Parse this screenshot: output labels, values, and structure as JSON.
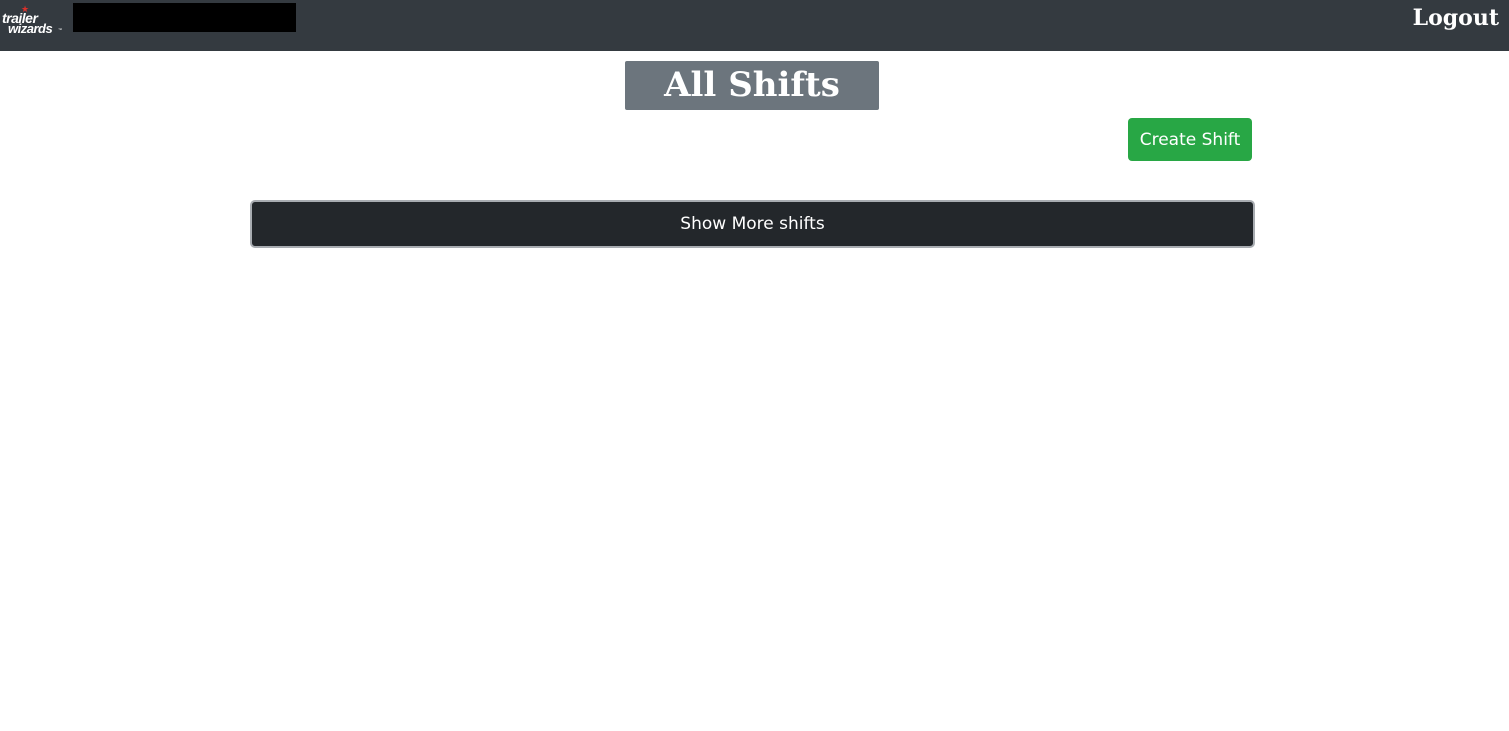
{
  "navbar": {
    "logo": {
      "line1": "trailer",
      "line2": "wizards",
      "icon": "star-icon",
      "accent_color": "#d9302a"
    },
    "logout_label": "Logout",
    "background_color": "#343a40"
  },
  "main": {
    "title": "All Shifts",
    "create_button_label": "Create Shift",
    "show_more_label": "Show More shifts"
  },
  "colors": {
    "title_bg": "#6c757d",
    "create_button_bg": "#28a745",
    "show_more_bg": "#23272b"
  }
}
